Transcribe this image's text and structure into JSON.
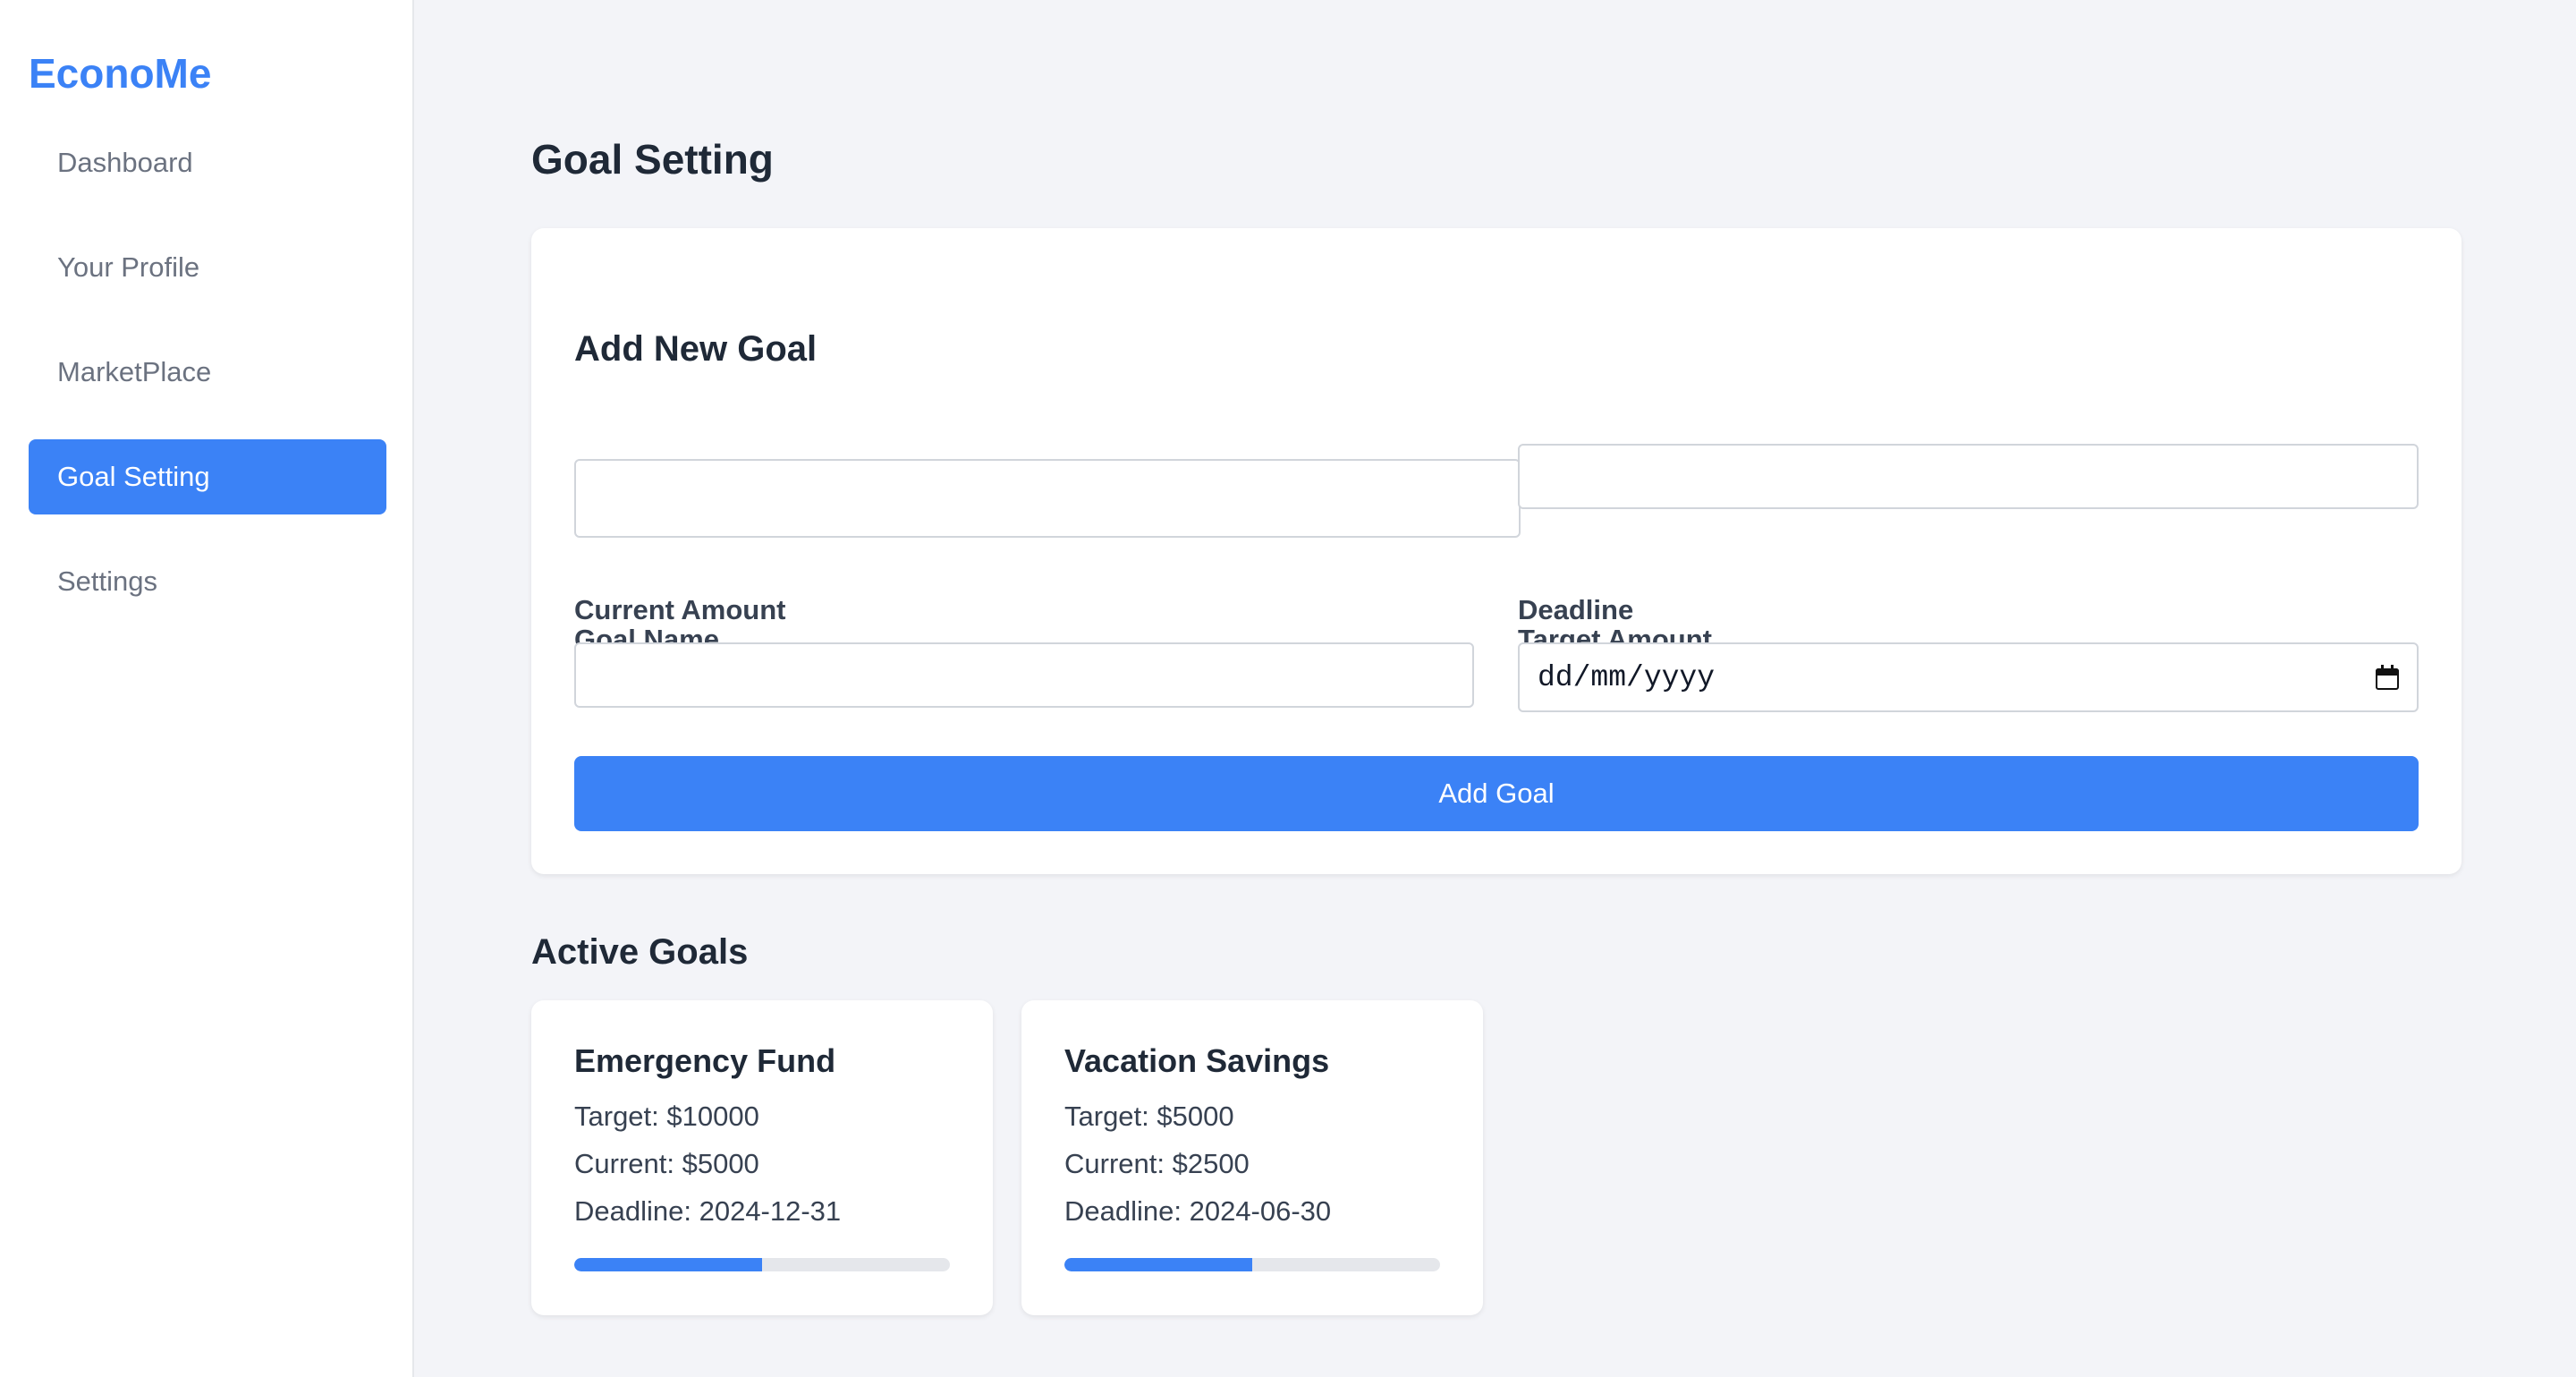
{
  "app": {
    "brand": "EconoMe"
  },
  "sidebar": {
    "items": [
      {
        "label": "Dashboard",
        "active": false
      },
      {
        "label": "Your Profile",
        "active": false
      },
      {
        "label": "MarketPlace",
        "active": false
      },
      {
        "label": "Goal Setting",
        "active": true
      },
      {
        "label": "Settings",
        "active": false
      }
    ]
  },
  "page": {
    "title": "Goal Setting"
  },
  "form": {
    "heading": "Add New Goal",
    "goal_name_label": "Goal Name",
    "goal_name_value": "",
    "target_amount_label": "Target Amount",
    "target_amount_value": "",
    "current_amount_label": "Current Amount",
    "current_amount_value": "",
    "deadline_label": "Deadline",
    "deadline_placeholder": "dd/mm/yyyy",
    "submit_label": "Add Goal"
  },
  "active_goals": {
    "title": "Active Goals",
    "goals": [
      {
        "name": "Emergency Fund",
        "target": "Target: $10000",
        "current": "Current: $5000",
        "deadline": "Deadline: 2024-12-31",
        "progress": 0.5
      },
      {
        "name": "Vacation Savings",
        "target": "Target: $5000",
        "current": "Current: $2500",
        "deadline": "Deadline: 2024-06-30",
        "progress": 0.5
      }
    ]
  },
  "colors": {
    "accent": "#3b82f6",
    "background": "#f3f4f8",
    "track": "#e5e7eb"
  },
  "icons": {
    "deadline_picker": "calendar-icon"
  }
}
